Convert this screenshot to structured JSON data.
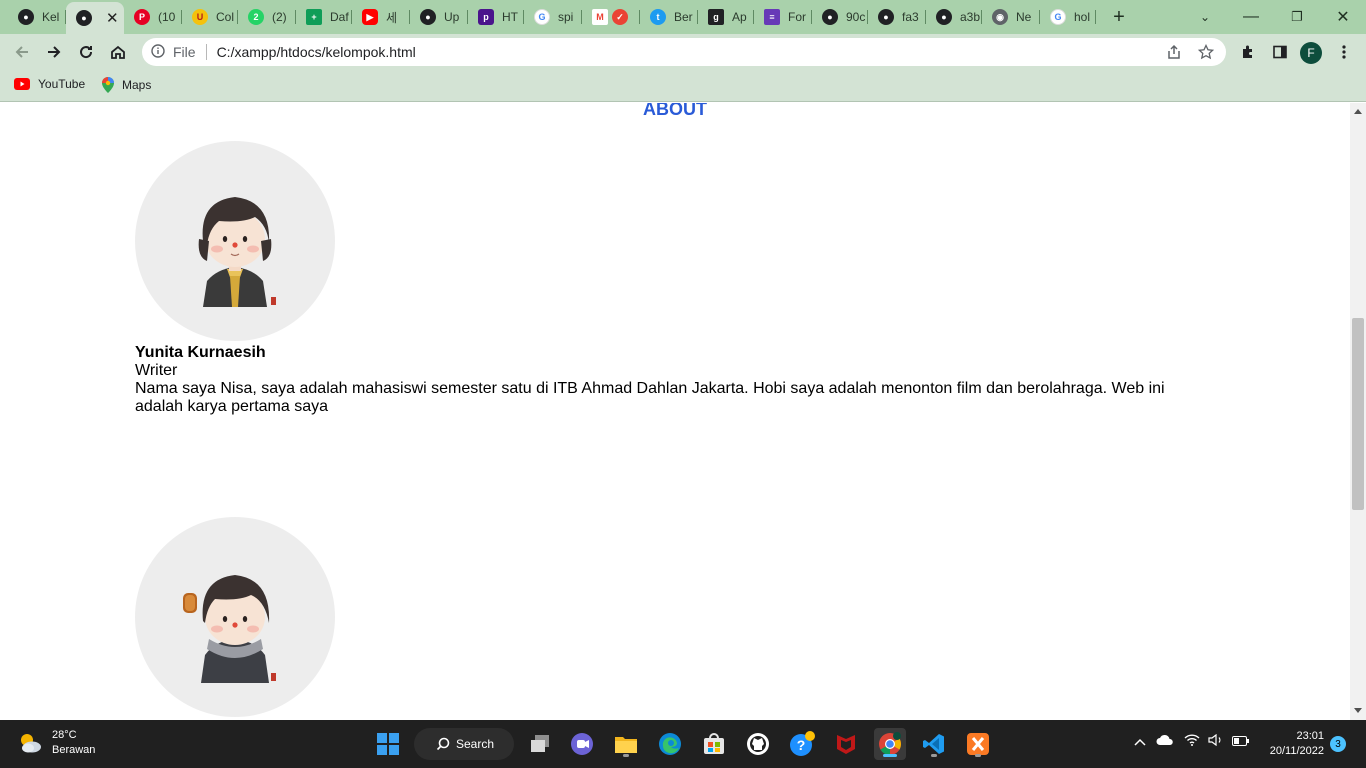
{
  "browser": {
    "tabs": [
      {
        "label": "Kel",
        "icon": "github-icon",
        "color": "#202124"
      },
      {
        "label": "",
        "icon": "github-icon",
        "color": "#202124",
        "active": true
      },
      {
        "label": "(10",
        "icon": "pinterest-icon",
        "color": "#e60023"
      },
      {
        "label": "Col",
        "icon": "mug-icon",
        "color": "#d93025"
      },
      {
        "label": "(2)",
        "icon": "whatsapp-icon",
        "color": "#25d366"
      },
      {
        "label": "Daf",
        "icon": "sheets-icon",
        "color": "#0f9d58"
      },
      {
        "label": "세",
        "icon": "youtube-icon",
        "color": "#ff0000"
      },
      {
        "label": "Up",
        "icon": "github-icon",
        "color": "#202124"
      },
      {
        "label": "HT",
        "icon": "book-icon",
        "color": "#4a148c"
      },
      {
        "label": "spi",
        "icon": "google-icon",
        "color": "#4285f4"
      },
      {
        "label": "",
        "icon": "gmail-icon",
        "color": "#ea4335"
      },
      {
        "label": "Ber",
        "icon": "twitter-icon",
        "color": "#1d9bf0"
      },
      {
        "label": "Ap",
        "icon": "g-square-icon",
        "color": "#202124"
      },
      {
        "label": "For",
        "icon": "form-icon",
        "color": "#673ab7"
      },
      {
        "label": "90c",
        "icon": "github-icon",
        "color": "#202124"
      },
      {
        "label": "fa3",
        "icon": "github-icon",
        "color": "#202124"
      },
      {
        "label": "a3b",
        "icon": "github-icon",
        "color": "#202124"
      },
      {
        "label": "Ne",
        "icon": "chrome-icon",
        "color": "#5f6368"
      },
      {
        "label": "hol",
        "icon": "google-icon",
        "color": "#4285f4"
      }
    ],
    "omnibox": {
      "scheme_label": "File",
      "url": "C:/xampp/htdocs/kelompok.html"
    },
    "profile_initial": "F",
    "bookmarks": [
      {
        "label": "YouTube",
        "icon": "youtube-icon"
      },
      {
        "label": "Maps",
        "icon": "maps-pin-icon"
      }
    ]
  },
  "page": {
    "title": "ABOUT",
    "people": [
      {
        "name": "Yunita Kurnaesih",
        "role": "Writer",
        "bio": "Nama saya Nisa, saya adalah mahasiswi semester satu di ITB Ahmad Dahlan Jakarta. Hobi saya adalah menonton film dan berolahraga. Web ini adalah karya pertama saya"
      }
    ]
  },
  "taskbar": {
    "weather_temp": "28°C",
    "weather_desc": "Berawan",
    "search_label": "Search",
    "time": "23:01",
    "date": "20/11/2022",
    "notifications": "3"
  },
  "colors": {
    "tabstrip": "#a9d1ab",
    "toolbar": "#d3e3d4",
    "title_blue": "#2a5bd7",
    "taskbar": "#202020"
  }
}
